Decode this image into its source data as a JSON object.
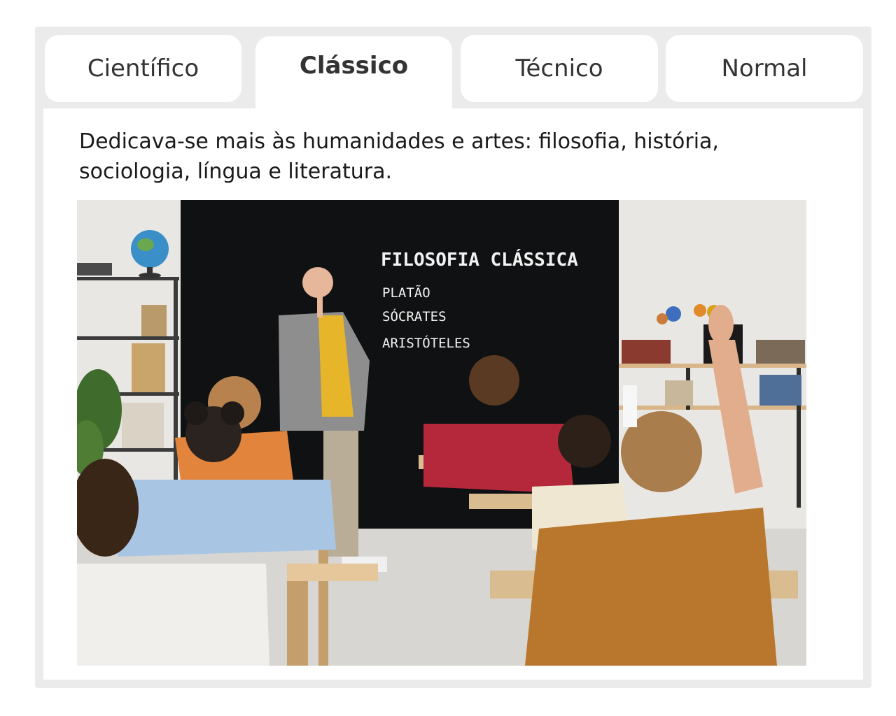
{
  "tabs": [
    {
      "label": "Científico",
      "active": false
    },
    {
      "label": "Clássico",
      "active": true
    },
    {
      "label": "Técnico",
      "active": false
    },
    {
      "label": "Normal",
      "active": false
    }
  ],
  "content": {
    "description": "Dedicava-se mais às humanidades e artes: filosofia, história, sociologia, língua e literatura."
  },
  "image": {
    "chalkboard": {
      "title": "FILOSOFIA CLÁSSICA",
      "items": [
        "PLATÃO",
        "SÓCRATES",
        "ARISTÓTELES"
      ]
    }
  },
  "colors": {
    "frame": "#ebebeb",
    "tab": "#ffffff",
    "text": "#333333",
    "chalkboard": "#0f1112"
  }
}
